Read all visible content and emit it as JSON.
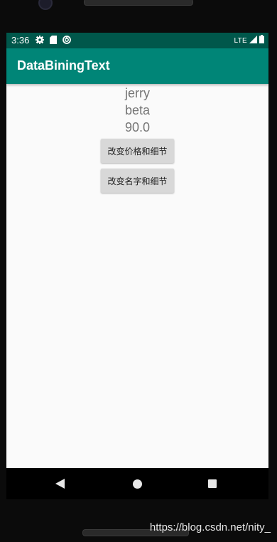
{
  "status_bar": {
    "time": "3:36",
    "network": "LTE",
    "icons": [
      "settings-icon",
      "sd-card-icon",
      "sync-icon",
      "signal-icon",
      "battery-icon"
    ]
  },
  "app_bar": {
    "title": "DataBiningText"
  },
  "content": {
    "name": "jerry",
    "detail": "beta",
    "price": "90.0",
    "button_price_label": "改变价格和细节",
    "button_name_label": "改变名字和细节"
  },
  "nav_bar": {
    "icons": [
      "back-icon",
      "home-icon",
      "recents-icon"
    ]
  },
  "watermark": "https://blog.csdn.net/nity_",
  "colors": {
    "status_bar": "#00574b",
    "app_bar": "#008577",
    "background": "#fafafa",
    "text_secondary": "#757575",
    "button": "#d8d8d8"
  }
}
